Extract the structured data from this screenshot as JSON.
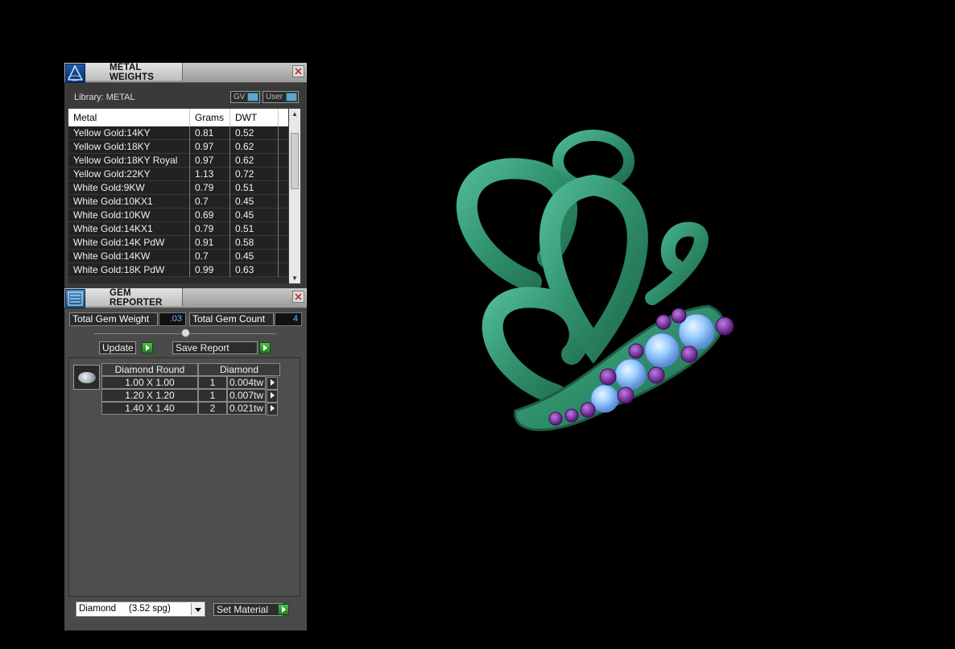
{
  "metal_weights": {
    "title": "METAL WEIGHTS",
    "library_label": "Library: METAL",
    "gv_label": "GV",
    "user_label": "User",
    "columns": [
      "Metal",
      "Grams",
      "DWT"
    ],
    "rows": [
      [
        "Yellow Gold:14KY",
        "0.81",
        "0.52"
      ],
      [
        "Yellow Gold:18KY",
        "0.97",
        "0.62"
      ],
      [
        "Yellow Gold:18KY Royal",
        "0.97",
        "0.62"
      ],
      [
        "Yellow Gold:22KY",
        "1.13",
        "0.72"
      ],
      [
        "White Gold:9KW",
        "0.79",
        "0.51"
      ],
      [
        "White Gold:10KX1",
        "0.7",
        "0.45"
      ],
      [
        "White Gold:10KW",
        "0.69",
        "0.45"
      ],
      [
        "White Gold:14KX1",
        "0.79",
        "0.51"
      ],
      [
        "White Gold:14K PdW",
        "0.91",
        "0.58"
      ],
      [
        "White Gold:14KW",
        "0.7",
        "0.45"
      ],
      [
        "White Gold:18K PdW",
        "0.99",
        "0.63"
      ]
    ]
  },
  "gem_reporter": {
    "title": "GEM REPORTER",
    "total_weight_label": "Total Gem Weight",
    "total_weight_value": ".03",
    "total_count_label": "Total Gem Count",
    "total_count_value": "4",
    "update_label": "Update",
    "save_report_label": "Save Report",
    "gem_header_shape": "Diamond Round",
    "gem_header_material": "Diamond",
    "gem_rows": [
      [
        "1.00 X 1.00",
        "1",
        "0.004tw"
      ],
      [
        "1.20 X 1.20",
        "1",
        "0.007tw"
      ],
      [
        "1.40 X 1.40",
        "2",
        "0.021tw"
      ]
    ],
    "material_select": "Diamond     (3.52 spg)",
    "set_material_label": "Set Material"
  },
  "colors": {
    "pendant_metal": "#2f8f6a",
    "gem_diamond": "#8cc8ff",
    "gem_amethyst": "#7a2fa0",
    "go_button": "#2fa02f"
  }
}
